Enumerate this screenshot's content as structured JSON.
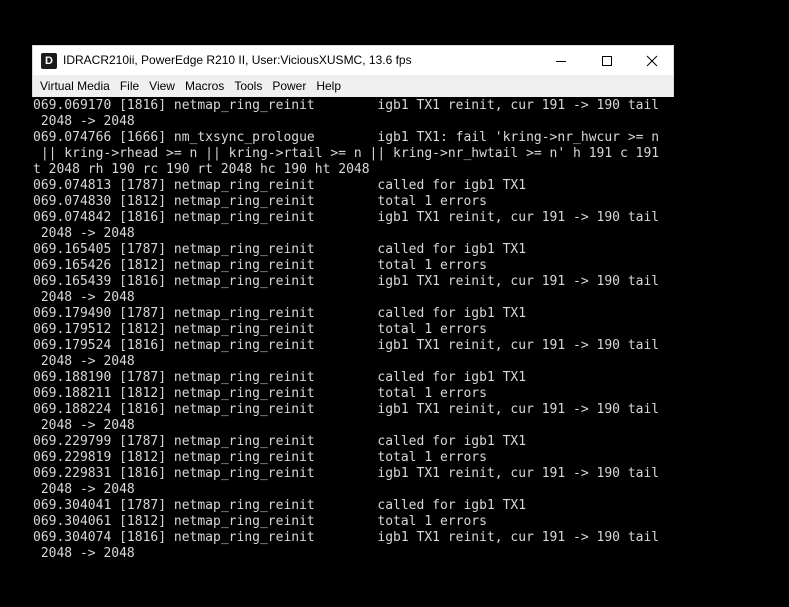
{
  "window": {
    "title": "IDRACR210ii, PowerEdge R210 II, User:ViciousXUSMC, 13.6 fps",
    "app_icon_letter": "D",
    "controls": {
      "minimize_icon": "minimize-icon",
      "maximize_icon": "maximize-icon",
      "close_icon": "close-icon"
    }
  },
  "menubar": {
    "items": [
      "Virtual Media",
      "File",
      "View",
      "Macros",
      "Tools",
      "Power",
      "Help"
    ]
  },
  "console": {
    "lines": [
      "069.069170 [1816] netmap_ring_reinit        igb1 TX1 reinit, cur 191 -> 190 tail",
      " 2048 -> 2048",
      "069.074766 [1666] nm_txsync_prologue        igb1 TX1: fail 'kring->nr_hwcur >= n",
      " || kring->rhead >= n || kring->rtail >= n || kring->nr_hwtail >= n' h 191 c 191",
      "t 2048 rh 190 rc 190 rt 2048 hc 190 ht 2048",
      "069.074813 [1787] netmap_ring_reinit        called for igb1 TX1",
      "069.074830 [1812] netmap_ring_reinit        total 1 errors",
      "069.074842 [1816] netmap_ring_reinit        igb1 TX1 reinit, cur 191 -> 190 tail",
      " 2048 -> 2048",
      "069.165405 [1787] netmap_ring_reinit        called for igb1 TX1",
      "069.165426 [1812] netmap_ring_reinit        total 1 errors",
      "069.165439 [1816] netmap_ring_reinit        igb1 TX1 reinit, cur 191 -> 190 tail",
      " 2048 -> 2048",
      "069.179490 [1787] netmap_ring_reinit        called for igb1 TX1",
      "069.179512 [1812] netmap_ring_reinit        total 1 errors",
      "069.179524 [1816] netmap_ring_reinit        igb1 TX1 reinit, cur 191 -> 190 tail",
      " 2048 -> 2048",
      "069.188190 [1787] netmap_ring_reinit        called for igb1 TX1",
      "069.188211 [1812] netmap_ring_reinit        total 1 errors",
      "069.188224 [1816] netmap_ring_reinit        igb1 TX1 reinit, cur 191 -> 190 tail",
      " 2048 -> 2048",
      "069.229799 [1787] netmap_ring_reinit        called for igb1 TX1",
      "069.229819 [1812] netmap_ring_reinit        total 1 errors",
      "069.229831 [1816] netmap_ring_reinit        igb1 TX1 reinit, cur 191 -> 190 tail",
      " 2048 -> 2048",
      "069.304041 [1787] netmap_ring_reinit        called for igb1 TX1",
      "069.304061 [1812] netmap_ring_reinit        total 1 errors",
      "069.304074 [1816] netmap_ring_reinit        igb1 TX1 reinit, cur 191 -> 190 tail",
      " 2048 -> 2048"
    ]
  },
  "colors": {
    "console_bg": "#000000",
    "console_text": "#d8d8d8",
    "titlebar_bg": "#ffffff",
    "menubar_bg": "#f0f0f0"
  }
}
